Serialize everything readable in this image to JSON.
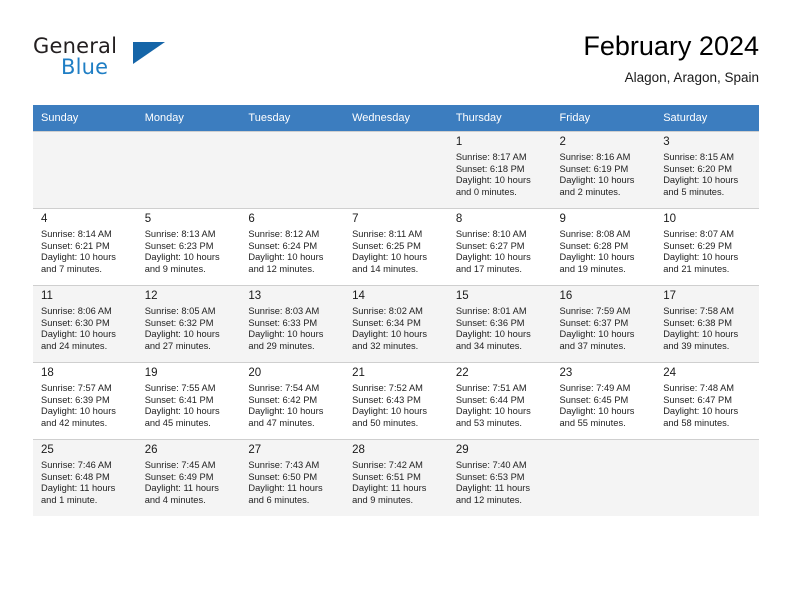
{
  "brand": {
    "name_top": "General",
    "name_bottom": "Blue",
    "triangle_color": "#1565a8",
    "blue_color": "#1f7ec4"
  },
  "header": {
    "title": "February 2024",
    "location": "Alagon, Aragon, Spain"
  },
  "theme": {
    "header_row_bg": "#3c7dbf",
    "header_row_text": "#ffffff",
    "shaded_row_bg": "#f4f4f4",
    "grid_line": "#cfcfcf"
  },
  "weekday_headers": [
    "Sunday",
    "Monday",
    "Tuesday",
    "Wednesday",
    "Thursday",
    "Friday",
    "Saturday"
  ],
  "weeks": [
    {
      "shaded": true,
      "days": [
        {
          "num": "",
          "sunrise": "",
          "sunset": "",
          "daylight_line1": "",
          "daylight_line2": ""
        },
        {
          "num": "",
          "sunrise": "",
          "sunset": "",
          "daylight_line1": "",
          "daylight_line2": ""
        },
        {
          "num": "",
          "sunrise": "",
          "sunset": "",
          "daylight_line1": "",
          "daylight_line2": ""
        },
        {
          "num": "",
          "sunrise": "",
          "sunset": "",
          "daylight_line1": "",
          "daylight_line2": ""
        },
        {
          "num": "1",
          "sunrise": "Sunrise: 8:17 AM",
          "sunset": "Sunset: 6:18 PM",
          "daylight_line1": "Daylight: 10 hours",
          "daylight_line2": "and 0 minutes."
        },
        {
          "num": "2",
          "sunrise": "Sunrise: 8:16 AM",
          "sunset": "Sunset: 6:19 PM",
          "daylight_line1": "Daylight: 10 hours",
          "daylight_line2": "and 2 minutes."
        },
        {
          "num": "3",
          "sunrise": "Sunrise: 8:15 AM",
          "sunset": "Sunset: 6:20 PM",
          "daylight_line1": "Daylight: 10 hours",
          "daylight_line2": "and 5 minutes."
        }
      ]
    },
    {
      "shaded": false,
      "days": [
        {
          "num": "4",
          "sunrise": "Sunrise: 8:14 AM",
          "sunset": "Sunset: 6:21 PM",
          "daylight_line1": "Daylight: 10 hours",
          "daylight_line2": "and 7 minutes."
        },
        {
          "num": "5",
          "sunrise": "Sunrise: 8:13 AM",
          "sunset": "Sunset: 6:23 PM",
          "daylight_line1": "Daylight: 10 hours",
          "daylight_line2": "and 9 minutes."
        },
        {
          "num": "6",
          "sunrise": "Sunrise: 8:12 AM",
          "sunset": "Sunset: 6:24 PM",
          "daylight_line1": "Daylight: 10 hours",
          "daylight_line2": "and 12 minutes."
        },
        {
          "num": "7",
          "sunrise": "Sunrise: 8:11 AM",
          "sunset": "Sunset: 6:25 PM",
          "daylight_line1": "Daylight: 10 hours",
          "daylight_line2": "and 14 minutes."
        },
        {
          "num": "8",
          "sunrise": "Sunrise: 8:10 AM",
          "sunset": "Sunset: 6:27 PM",
          "daylight_line1": "Daylight: 10 hours",
          "daylight_line2": "and 17 minutes."
        },
        {
          "num": "9",
          "sunrise": "Sunrise: 8:08 AM",
          "sunset": "Sunset: 6:28 PM",
          "daylight_line1": "Daylight: 10 hours",
          "daylight_line2": "and 19 minutes."
        },
        {
          "num": "10",
          "sunrise": "Sunrise: 8:07 AM",
          "sunset": "Sunset: 6:29 PM",
          "daylight_line1": "Daylight: 10 hours",
          "daylight_line2": "and 21 minutes."
        }
      ]
    },
    {
      "shaded": true,
      "days": [
        {
          "num": "11",
          "sunrise": "Sunrise: 8:06 AM",
          "sunset": "Sunset: 6:30 PM",
          "daylight_line1": "Daylight: 10 hours",
          "daylight_line2": "and 24 minutes."
        },
        {
          "num": "12",
          "sunrise": "Sunrise: 8:05 AM",
          "sunset": "Sunset: 6:32 PM",
          "daylight_line1": "Daylight: 10 hours",
          "daylight_line2": "and 27 minutes."
        },
        {
          "num": "13",
          "sunrise": "Sunrise: 8:03 AM",
          "sunset": "Sunset: 6:33 PM",
          "daylight_line1": "Daylight: 10 hours",
          "daylight_line2": "and 29 minutes."
        },
        {
          "num": "14",
          "sunrise": "Sunrise: 8:02 AM",
          "sunset": "Sunset: 6:34 PM",
          "daylight_line1": "Daylight: 10 hours",
          "daylight_line2": "and 32 minutes."
        },
        {
          "num": "15",
          "sunrise": "Sunrise: 8:01 AM",
          "sunset": "Sunset: 6:36 PM",
          "daylight_line1": "Daylight: 10 hours",
          "daylight_line2": "and 34 minutes."
        },
        {
          "num": "16",
          "sunrise": "Sunrise: 7:59 AM",
          "sunset": "Sunset: 6:37 PM",
          "daylight_line1": "Daylight: 10 hours",
          "daylight_line2": "and 37 minutes."
        },
        {
          "num": "17",
          "sunrise": "Sunrise: 7:58 AM",
          "sunset": "Sunset: 6:38 PM",
          "daylight_line1": "Daylight: 10 hours",
          "daylight_line2": "and 39 minutes."
        }
      ]
    },
    {
      "shaded": false,
      "days": [
        {
          "num": "18",
          "sunrise": "Sunrise: 7:57 AM",
          "sunset": "Sunset: 6:39 PM",
          "daylight_line1": "Daylight: 10 hours",
          "daylight_line2": "and 42 minutes."
        },
        {
          "num": "19",
          "sunrise": "Sunrise: 7:55 AM",
          "sunset": "Sunset: 6:41 PM",
          "daylight_line1": "Daylight: 10 hours",
          "daylight_line2": "and 45 minutes."
        },
        {
          "num": "20",
          "sunrise": "Sunrise: 7:54 AM",
          "sunset": "Sunset: 6:42 PM",
          "daylight_line1": "Daylight: 10 hours",
          "daylight_line2": "and 47 minutes."
        },
        {
          "num": "21",
          "sunrise": "Sunrise: 7:52 AM",
          "sunset": "Sunset: 6:43 PM",
          "daylight_line1": "Daylight: 10 hours",
          "daylight_line2": "and 50 minutes."
        },
        {
          "num": "22",
          "sunrise": "Sunrise: 7:51 AM",
          "sunset": "Sunset: 6:44 PM",
          "daylight_line1": "Daylight: 10 hours",
          "daylight_line2": "and 53 minutes."
        },
        {
          "num": "23",
          "sunrise": "Sunrise: 7:49 AM",
          "sunset": "Sunset: 6:45 PM",
          "daylight_line1": "Daylight: 10 hours",
          "daylight_line2": "and 55 minutes."
        },
        {
          "num": "24",
          "sunrise": "Sunrise: 7:48 AM",
          "sunset": "Sunset: 6:47 PM",
          "daylight_line1": "Daylight: 10 hours",
          "daylight_line2": "and 58 minutes."
        }
      ]
    },
    {
      "shaded": true,
      "days": [
        {
          "num": "25",
          "sunrise": "Sunrise: 7:46 AM",
          "sunset": "Sunset: 6:48 PM",
          "daylight_line1": "Daylight: 11 hours",
          "daylight_line2": "and 1 minute."
        },
        {
          "num": "26",
          "sunrise": "Sunrise: 7:45 AM",
          "sunset": "Sunset: 6:49 PM",
          "daylight_line1": "Daylight: 11 hours",
          "daylight_line2": "and 4 minutes."
        },
        {
          "num": "27",
          "sunrise": "Sunrise: 7:43 AM",
          "sunset": "Sunset: 6:50 PM",
          "daylight_line1": "Daylight: 11 hours",
          "daylight_line2": "and 6 minutes."
        },
        {
          "num": "28",
          "sunrise": "Sunrise: 7:42 AM",
          "sunset": "Sunset: 6:51 PM",
          "daylight_line1": "Daylight: 11 hours",
          "daylight_line2": "and 9 minutes."
        },
        {
          "num": "29",
          "sunrise": "Sunrise: 7:40 AM",
          "sunset": "Sunset: 6:53 PM",
          "daylight_line1": "Daylight: 11 hours",
          "daylight_line2": "and 12 minutes."
        },
        {
          "num": "",
          "sunrise": "",
          "sunset": "",
          "daylight_line1": "",
          "daylight_line2": ""
        },
        {
          "num": "",
          "sunrise": "",
          "sunset": "",
          "daylight_line1": "",
          "daylight_line2": ""
        }
      ]
    }
  ]
}
